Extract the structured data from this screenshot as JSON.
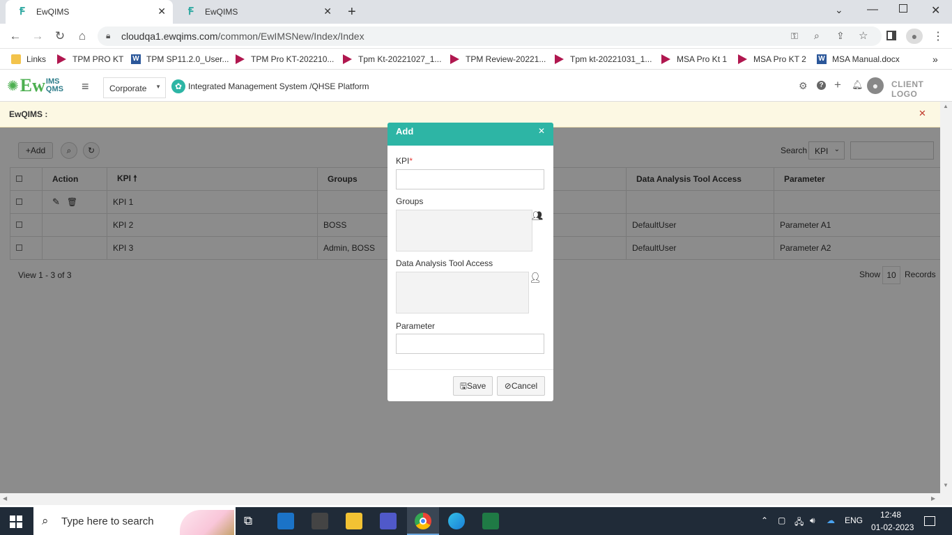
{
  "browser": {
    "tabs": [
      {
        "title": "EwQIMS",
        "active": true
      },
      {
        "title": "EwQIMS",
        "active": false
      }
    ],
    "url_host": "cloudqa1.ewqims.com",
    "url_path": "/common/EwIMSNew/Index/Index",
    "bookmarks": [
      {
        "label": "Links",
        "icon": "folder-icon"
      },
      {
        "label": "TPM PRO KT",
        "icon": "video-icon"
      },
      {
        "label": "TPM SP11.2.0_User...",
        "icon": "word-icon"
      },
      {
        "label": "TPM Pro KT-202210...",
        "icon": "video-icon"
      },
      {
        "label": "Tpm Kt-20221027_1...",
        "icon": "video-icon"
      },
      {
        "label": "TPM Review-20221...",
        "icon": "video-icon"
      },
      {
        "label": "Tpm kt-20221031_1...",
        "icon": "video-icon"
      },
      {
        "label": "MSA Pro Kt 1",
        "icon": "video-icon"
      },
      {
        "label": "MSA Pro KT 2",
        "icon": "video-icon"
      },
      {
        "label": "MSA Manual.docx",
        "icon": "word-icon"
      }
    ]
  },
  "app": {
    "logo_text": "EwIMS QMS",
    "logo_main": "Ew",
    "logo_sup": "IMS",
    "logo_sub": "QMS",
    "site_select": "Corporate",
    "platform_title": "Integrated Management System /QHSE Platform",
    "client_logo": "CLIENT LOGO",
    "notice": "EwQIMS :"
  },
  "grid": {
    "add_label": "+Add",
    "search_label": "Search",
    "search_field": "KPI",
    "columns": [
      "",
      "Action",
      "KPI",
      "Groups",
      "Data Analysis Tool Access",
      "Parameter"
    ],
    "rows": [
      {
        "kpi": "KPI 1",
        "groups": "",
        "access": "",
        "parameter": ""
      },
      {
        "kpi": "KPI 2",
        "groups": "BOSS",
        "access": "DefaultUser",
        "parameter": "Parameter A1"
      },
      {
        "kpi": "KPI 3",
        "groups": "Admin, BOSS",
        "access": "DefaultUser",
        "parameter": "Parameter A2"
      }
    ],
    "footer_view": "View 1 - 3 of 3",
    "show_label": "Show",
    "records_count": "10",
    "records_label": "Records"
  },
  "modal": {
    "title": "Add",
    "kpi_label": "KPI",
    "required_mark": "*",
    "groups_label": "Groups",
    "access_label": "Data Analysis Tool Access",
    "parameter_label": "Parameter",
    "save_label": "Save",
    "cancel_label": "Cancel"
  },
  "taskbar": {
    "search_placeholder": "Type here to search",
    "language": "ENG",
    "time": "12:48",
    "date": "01-02-2023"
  },
  "colors": {
    "accent": "#2db5a5",
    "brand_green": "#4caf50",
    "notice_bg": "#fcf8e3"
  }
}
